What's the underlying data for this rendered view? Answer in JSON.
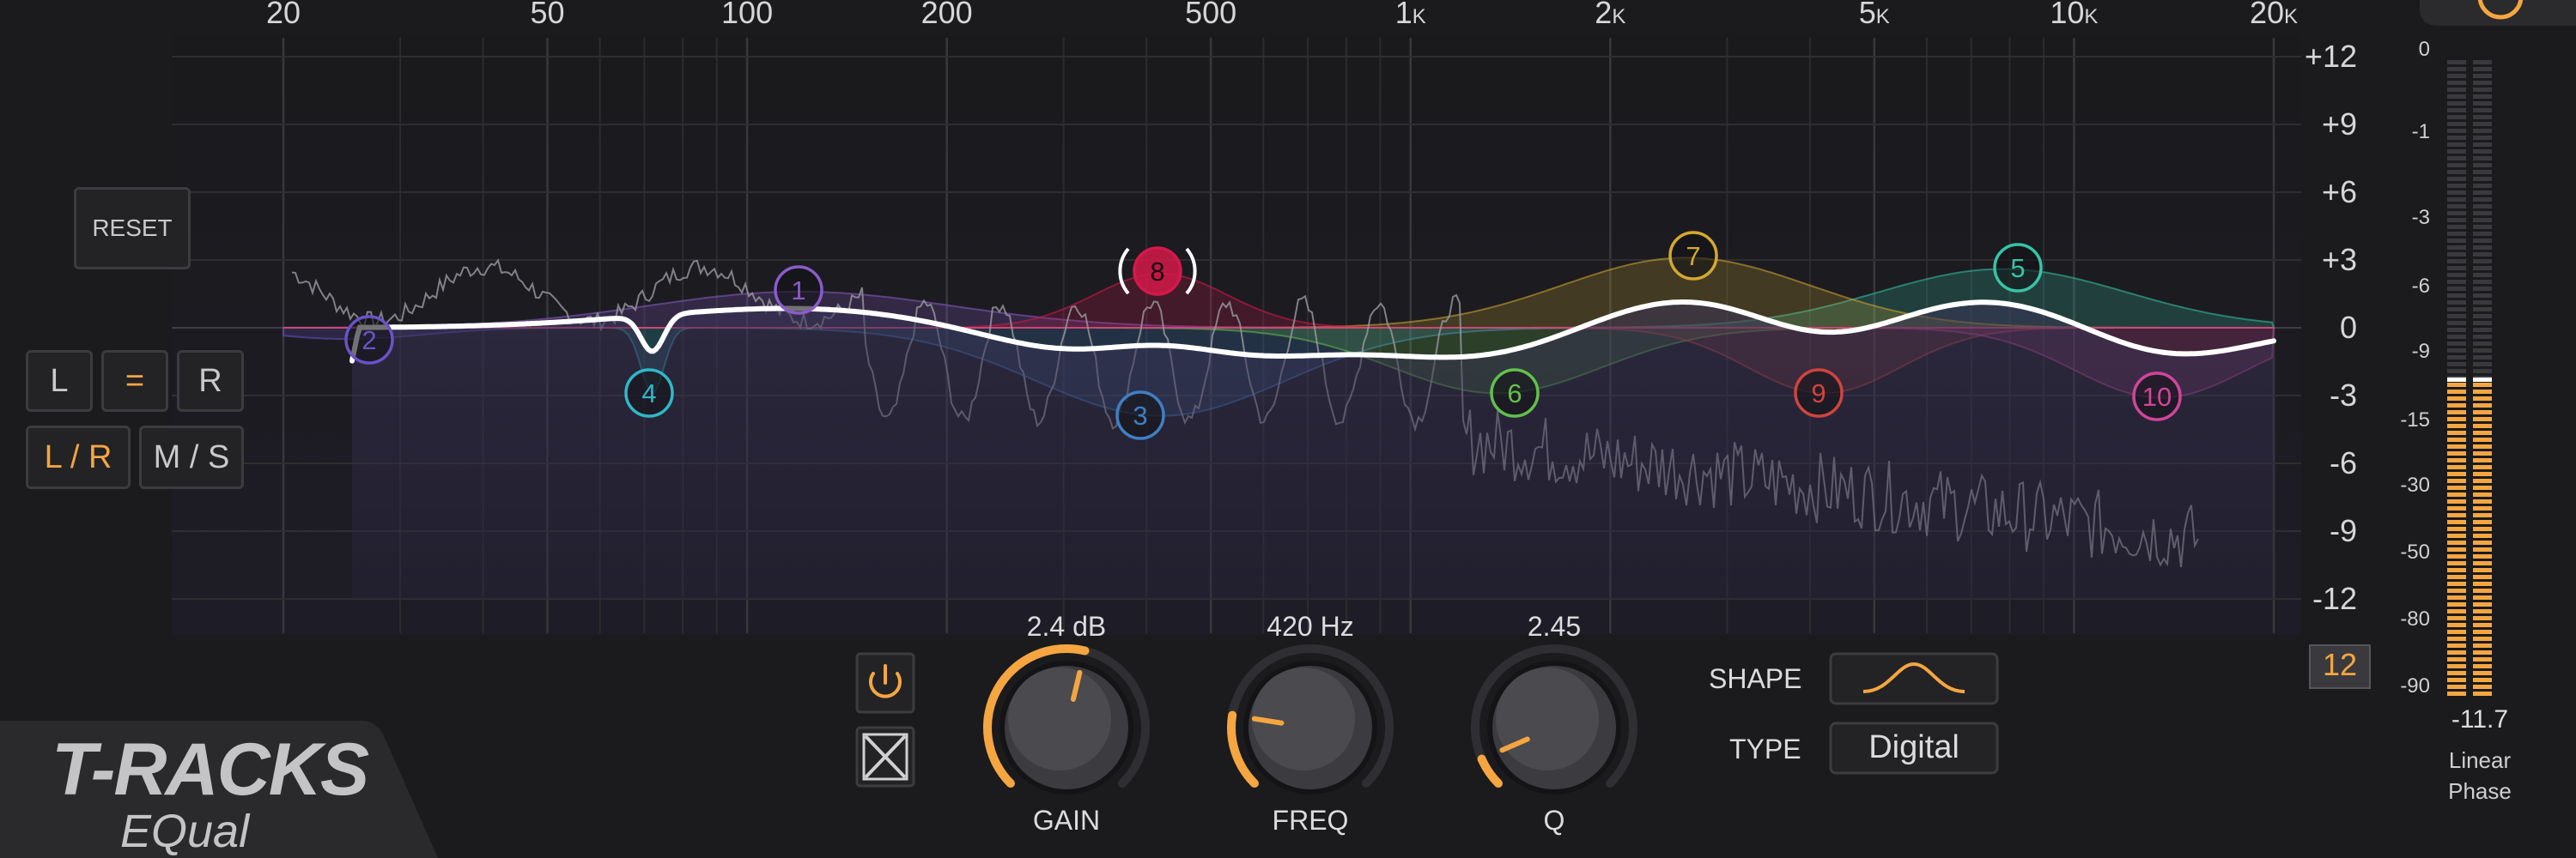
{
  "freq_axis": [
    {
      "label": "20",
      "k": ""
    },
    {
      "label": "50",
      "k": ""
    },
    {
      "label": "100",
      "k": ""
    },
    {
      "label": "200",
      "k": ""
    },
    {
      "label": "500",
      "k": ""
    },
    {
      "label": "1",
      "k": "K"
    },
    {
      "label": "2",
      "k": "K"
    },
    {
      "label": "5",
      "k": "K"
    },
    {
      "label": "10",
      "k": "K"
    },
    {
      "label": "20",
      "k": "K"
    }
  ],
  "db_axis": [
    "+12",
    "+9",
    "+6",
    "+3",
    "0",
    "-3",
    "-6",
    "-9",
    "-12"
  ],
  "left_panel": {
    "reset_label": "RESET",
    "l_label": "L",
    "link_label": "=",
    "r_label": "R",
    "lr_label": "L / R",
    "ms_label": "M / S"
  },
  "bands": [
    {
      "id": "1",
      "color": "#8a5cc9"
    },
    {
      "id": "2",
      "color": "#6a52c8"
    },
    {
      "id": "3",
      "color": "#3f7fc4"
    },
    {
      "id": "4",
      "color": "#2fb8c9"
    },
    {
      "id": "5",
      "color": "#35c4a6"
    },
    {
      "id": "6",
      "color": "#62c04a"
    },
    {
      "id": "7",
      "color": "#d3a92f"
    },
    {
      "id": "8",
      "color": "#d3194a"
    },
    {
      "id": "9",
      "color": "#d0443e"
    },
    {
      "id": "10",
      "color": "#d0459a"
    }
  ],
  "controls": {
    "gain_value": "2.4 dB",
    "gain_label": "GAIN",
    "freq_value": "420 Hz",
    "freq_label": "FREQ",
    "q_value": "2.45",
    "q_label": "Q",
    "shape_label": "SHAPE",
    "type_label": "TYPE",
    "type_value": "Digital",
    "output_value": "12"
  },
  "meter": {
    "scale": [
      "0",
      "-1",
      "-3",
      "-6",
      "-9",
      "-15",
      "-30",
      "-50",
      "-80",
      "-90"
    ],
    "readout": "-11.7",
    "mode_line1": "Linear",
    "mode_line2": "Phase"
  },
  "brand": {
    "title": "T-RACKS",
    "subtitle": "EQual"
  },
  "colors": {
    "accent": "#f5a640",
    "curve": "#ffffff"
  }
}
